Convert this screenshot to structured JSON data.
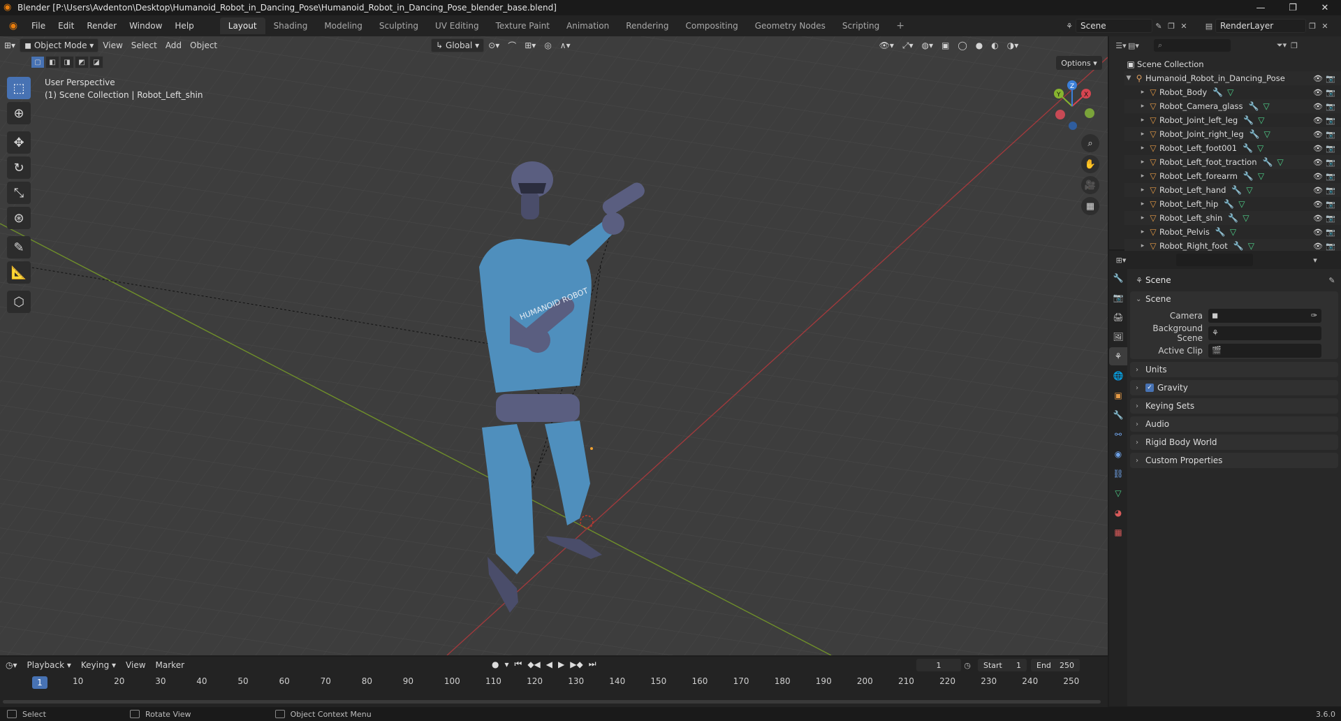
{
  "window": {
    "title": "Blender [P:\\Users\\Avdenton\\Desktop\\Humanoid_Robot_in_Dancing_Pose\\Humanoid_Robot_in_Dancing_Pose_blender_base.blend]",
    "controls": {
      "minimize": "—",
      "maximize": "❐",
      "close": "✕"
    }
  },
  "menu": [
    "File",
    "Edit",
    "Render",
    "Window",
    "Help"
  ],
  "workspaces": [
    "Layout",
    "Shading",
    "Modeling",
    "Sculpting",
    "UV Editing",
    "Texture Paint",
    "Animation",
    "Rendering",
    "Compositing",
    "Geometry Nodes",
    "Scripting"
  ],
  "active_workspace": "Layout",
  "scene_name": "Scene",
  "view_layer": "RenderLayer",
  "viewport": {
    "mode": "Object Mode",
    "menus": [
      "View",
      "Select",
      "Add",
      "Object"
    ],
    "transform_orientation": "Global",
    "options_label": "Options",
    "info_line1": "User Perspective",
    "info_line2": "(1) Scene Collection | Robot_Left_shin",
    "robot_shirt_text": "HUMANOID ROBOT",
    "gizmo": {
      "x": "X",
      "y": "Y",
      "z": "Z"
    }
  },
  "outliner": {
    "root": "Scene Collection",
    "collection": "Humanoid_Robot_in_Dancing_Pose",
    "objects": [
      "Robot_Body",
      "Robot_Camera_glass",
      "Robot_Joint_left_leg",
      "Robot_Joint_right_leg",
      "Robot_Left_foot001",
      "Robot_Left_foot_traction",
      "Robot_Left_forearm",
      "Robot_Left_hand",
      "Robot_Left_hip",
      "Robot_Left_shin",
      "Robot_Pelvis",
      "Robot_Right_foot"
    ],
    "active_object": "Robot_Left_shin"
  },
  "properties": {
    "context_title": "Scene",
    "panel_scene": "Scene",
    "camera_label": "Camera",
    "background_scene_label": "Background Scene",
    "active_clip_label": "Active Clip",
    "panels": [
      "Units",
      "Gravity",
      "Keying Sets",
      "Audio",
      "Rigid Body World",
      "Custom Properties"
    ],
    "gravity_checked": true
  },
  "timeline": {
    "menus": [
      "Playback",
      "Keying",
      "View",
      "Marker"
    ],
    "current_frame": "1",
    "start_label": "Start",
    "start": "1",
    "end_label": "End",
    "end": "250",
    "ticks": [
      "1",
      "10",
      "20",
      "30",
      "40",
      "50",
      "60",
      "70",
      "80",
      "90",
      "100",
      "110",
      "120",
      "130",
      "140",
      "150",
      "160",
      "170",
      "180",
      "190",
      "200",
      "210",
      "220",
      "230",
      "240",
      "250"
    ]
  },
  "statusbar": {
    "select": "Select",
    "rotate_view": "Rotate View",
    "context_menu": "Object Context Menu",
    "version": "3.6.0"
  },
  "colors": {
    "accent": "#4772b3",
    "x_axis": "#d64550",
    "y_axis": "#87b52f",
    "z_axis": "#3b7fd9",
    "robot_suit": "#4f8fbd",
    "robot_metal": "#5a5e80"
  }
}
